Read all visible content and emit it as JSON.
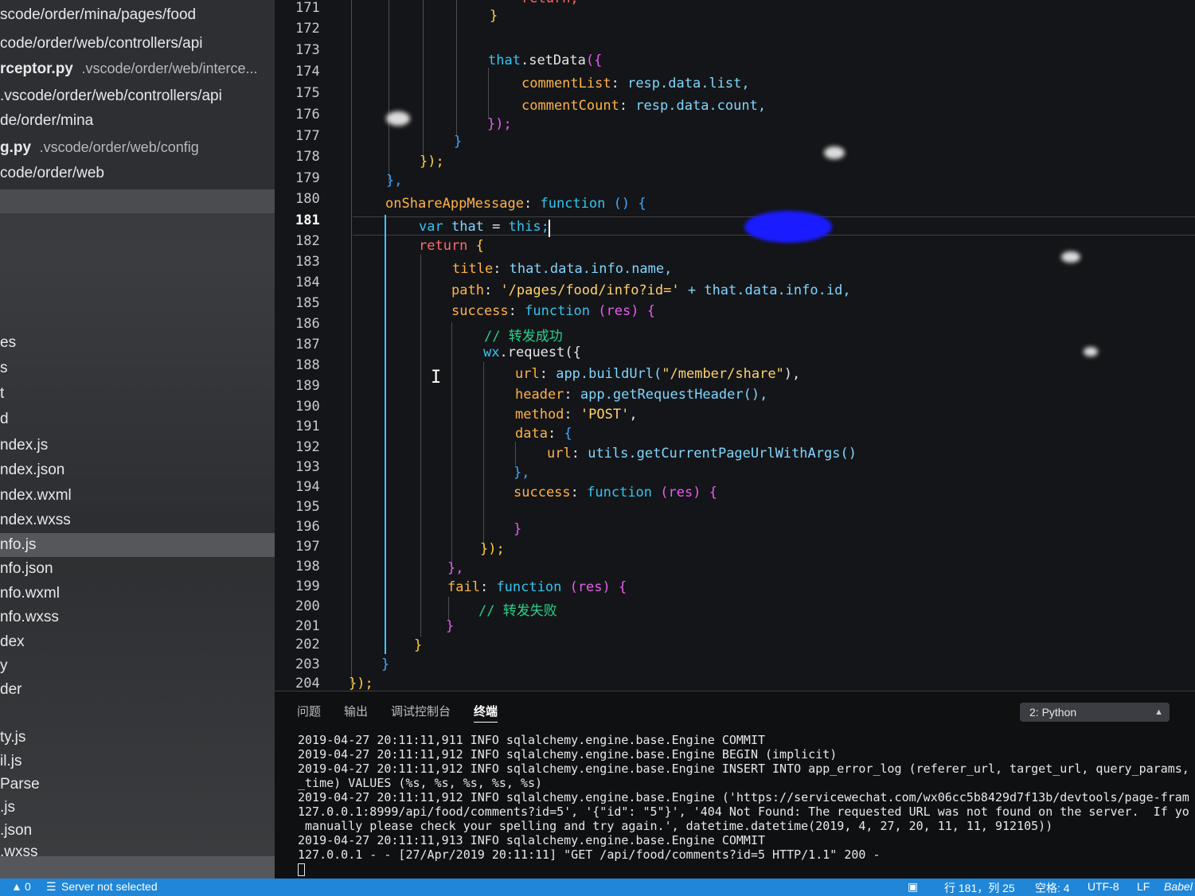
{
  "sidebar": {
    "items_top": [
      {
        "name": "scode/order/mina/pages/food",
        "path": ""
      },
      {
        "name": "code/order/web/controllers/api",
        "path": ""
      },
      {
        "name": "rceptor.py",
        "path": ".vscode/order/web/interce..."
      },
      {
        "name": ".vscode/order/web/controllers/api",
        "path": ""
      },
      {
        "name": "de/order/mina",
        "path": ""
      },
      {
        "name": "g.py",
        "path": ".vscode/order/web/config"
      },
      {
        "name": "code/order/web",
        "path": ""
      }
    ],
    "items_tree": [
      "es",
      "s",
      "t",
      "d",
      "ndex.js",
      "ndex.json",
      "ndex.wxml",
      "ndex.wxss",
      "nfo.js",
      "nfo.json",
      "nfo.wxml",
      "nfo.wxss",
      "dex",
      "y",
      "der",
      "",
      "ty.js",
      "il.js",
      "Parse",
      ".js",
      ".json",
      ".wxss"
    ],
    "active_index": 8
  },
  "editor": {
    "line_numbers": [
      "171",
      "172",
      "173",
      "174",
      "175",
      "176",
      "177",
      "178",
      "179",
      "180",
      "181",
      "182",
      "183",
      "184",
      "185",
      "186",
      "187",
      "188",
      "189",
      "190",
      "191",
      "192",
      "193",
      "194",
      "195",
      "196",
      "197",
      "198",
      "199",
      "200",
      "201",
      "202",
      "203",
      "204"
    ],
    "current_line": "181",
    "code": {
      "l171": "return;",
      "l172": "}",
      "l174_obj": "that",
      "l174_fn": "setData",
      "l175_key": "commentList",
      "l175_val": "resp.data.list,",
      "l176_key": "commentCount",
      "l176_val": "resp.data.count,",
      "l177": "});",
      "l178": "}",
      "l179": "});",
      "l180": "},",
      "l181_key": "onShareAppMessage",
      "l181_fn": "function",
      "l181_rest": "() {",
      "l182_var": "var",
      "l182_name": "that",
      "l182_eq": "=",
      "l182_this": "this;",
      "l183_ret": "return",
      "l183_br": "{",
      "l184_key": "title",
      "l184_val": "that.data.info.name,",
      "l185_key": "path",
      "l185_str": "'/pages/food/info?id='",
      "l185_rest": "+ that.data.info.id,",
      "l186_key": "success",
      "l186_fn": "function",
      "l186_rest": "(res) {",
      "l187": "// 转发成功",
      "l188_obj": "wx",
      "l188_fn": "request({",
      "l189_key": "url",
      "l189_call": "app.buildUrl(",
      "l189_str": "\"/member/share\"",
      "l189_end": "),",
      "l190_key": "header",
      "l190_val": "app.getRequestHeader(),",
      "l191_key": "method",
      "l191_str": "'POST'",
      "l191_end": ",",
      "l192_key": "data",
      "l192_br": "{",
      "l193_key": "url",
      "l193_val": "utils.getCurrentPageUrlWithArgs()",
      "l194": "},",
      "l195_key": "success",
      "l195_fn": "function",
      "l195_rest": "(res) {",
      "l197": "}",
      "l198": "});",
      "l199": "},",
      "l200_key": "fail",
      "l200_fn": "function",
      "l200_rest": "(res) {",
      "l201": "// 转发失败",
      "l202": "}",
      "l203": "}",
      "l204": "}",
      "l205": "});"
    }
  },
  "panel": {
    "tabs": [
      "问题",
      "输出",
      "调试控制台",
      "终端"
    ],
    "active_tab": "终端",
    "terminal_select": "2: Python",
    "terminal_lines": [
      "2019-04-27 20:11:11,911 INFO sqlalchemy.engine.base.Engine COMMIT",
      "2019-04-27 20:11:11,912 INFO sqlalchemy.engine.base.Engine BEGIN (implicit)",
      "2019-04-27 20:11:11,912 INFO sqlalchemy.engine.base.Engine INSERT INTO app_error_log (referer_url, target_url, query_params,",
      "_time) VALUES (%s, %s, %s, %s, %s)",
      "2019-04-27 20:11:11,912 INFO sqlalchemy.engine.base.Engine ('https://servicewechat.com/wx06cc5b8429d7f13b/devtools/page-fram",
      "127.0.0.1:8999/api/food/comments?id=5', '{\"id\": \"5\"}', '404 Not Found: The requested URL was not found on the server.  If yo",
      " manually please check your spelling and try again.', datetime.datetime(2019, 4, 27, 20, 11, 11, 912105))",
      "2019-04-27 20:11:11,913 INFO sqlalchemy.engine.base.Engine COMMIT",
      "127.0.0.1 - - [27/Apr/2019 20:11:11] \"GET /api/food/comments?id=5 HTTP/1.1\" 200 -"
    ]
  },
  "statusbar": {
    "warnings": "0",
    "server": "Server not selected",
    "position": "行 181，列 25",
    "spaces": "空格: 4",
    "encoding": "UTF-8",
    "eol": "LF",
    "language": "Babel"
  },
  "colors": {
    "statusbar": "#1f86d8",
    "keyword": "#33c4f0",
    "property": "#ffb347",
    "string": "#ffd36b",
    "comment": "#29d18a"
  }
}
